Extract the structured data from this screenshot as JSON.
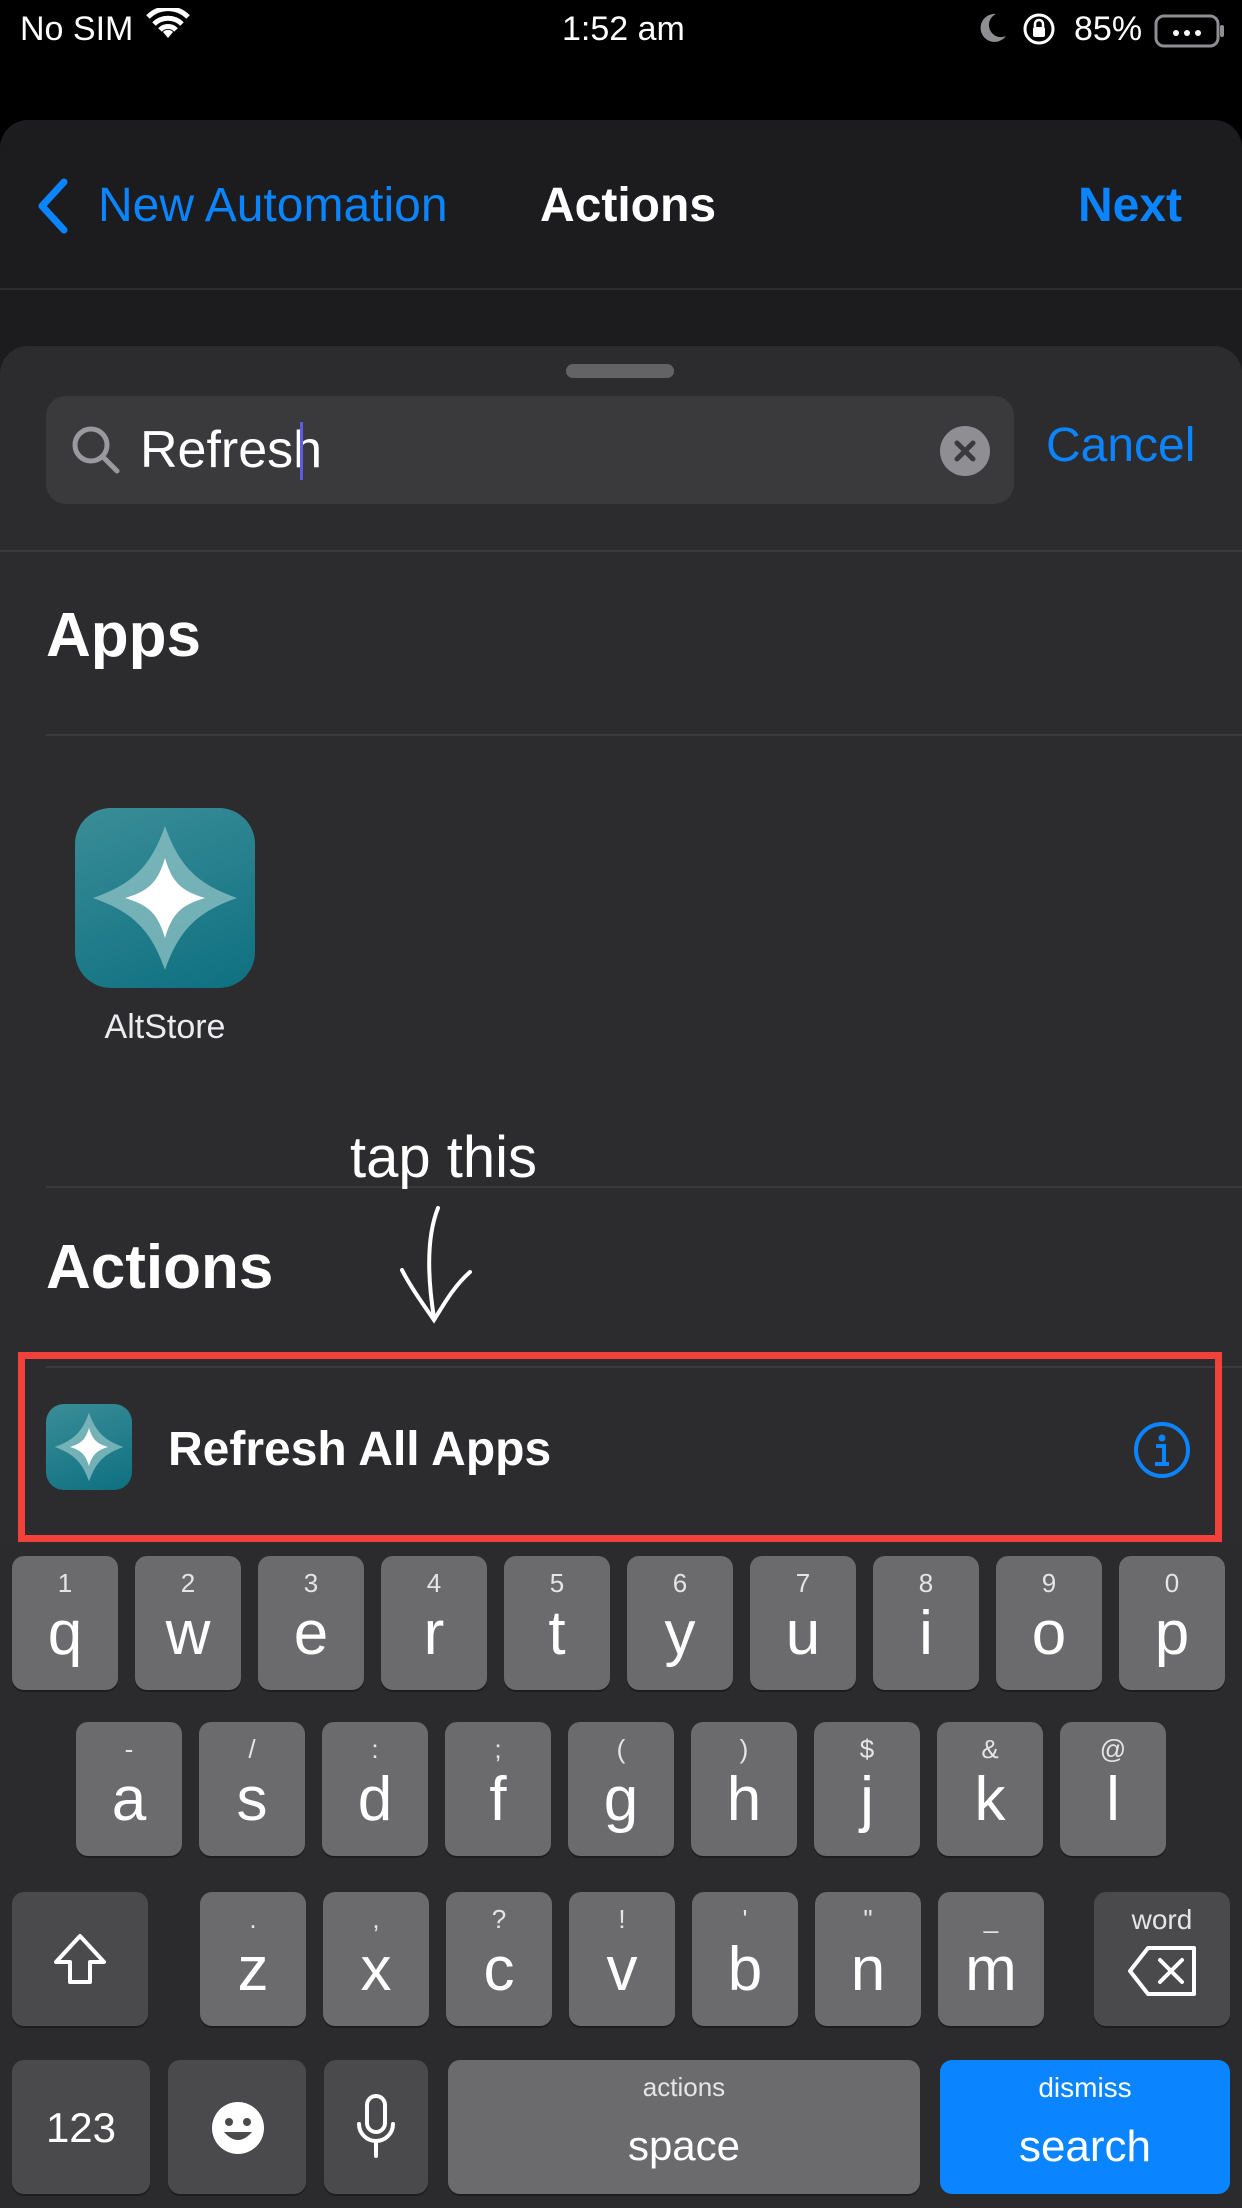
{
  "status_bar": {
    "carrier": "No SIM",
    "time": "1:52 am",
    "battery": "85%"
  },
  "nav": {
    "back_label": "New Automation",
    "title": "Actions",
    "next_label": "Next"
  },
  "search": {
    "value": "Refresh",
    "cancel_label": "Cancel"
  },
  "sections": {
    "apps_header": "Apps",
    "apps": [
      {
        "name": "AltStore"
      }
    ],
    "actions_header": "Actions",
    "actions": [
      {
        "label": "Refresh All Apps"
      }
    ]
  },
  "annotation": {
    "text": "tap this",
    "color": "#f2403a"
  },
  "keyboard": {
    "row1": [
      {
        "hint": "1",
        "ch": "q"
      },
      {
        "hint": "2",
        "ch": "w"
      },
      {
        "hint": "3",
        "ch": "e"
      },
      {
        "hint": "4",
        "ch": "r"
      },
      {
        "hint": "5",
        "ch": "t"
      },
      {
        "hint": "6",
        "ch": "y"
      },
      {
        "hint": "7",
        "ch": "u"
      },
      {
        "hint": "8",
        "ch": "i"
      },
      {
        "hint": "9",
        "ch": "o"
      },
      {
        "hint": "0",
        "ch": "p"
      }
    ],
    "row2": [
      {
        "hint": "-",
        "ch": "a"
      },
      {
        "hint": "/",
        "ch": "s"
      },
      {
        "hint": ":",
        "ch": "d"
      },
      {
        "hint": ";",
        "ch": "f"
      },
      {
        "hint": "(",
        "ch": "g"
      },
      {
        "hint": ")",
        "ch": "h"
      },
      {
        "hint": "$",
        "ch": "j"
      },
      {
        "hint": "&",
        "ch": "k"
      },
      {
        "hint": "@",
        "ch": "l"
      }
    ],
    "row3": [
      {
        "hint": ".",
        "ch": "z"
      },
      {
        "hint": ",",
        "ch": "x"
      },
      {
        "hint": "?",
        "ch": "c"
      },
      {
        "hint": "!",
        "ch": "v"
      },
      {
        "hint": "'",
        "ch": "b"
      },
      {
        "hint": "\"",
        "ch": "n"
      },
      {
        "hint": "_",
        "ch": "m"
      }
    ],
    "delete_hint": "word",
    "numbers_label": "123",
    "space_hint": "actions",
    "space_label": "space",
    "search_hint": "dismiss",
    "search_label": "search",
    "accent": "#0a84ff"
  }
}
